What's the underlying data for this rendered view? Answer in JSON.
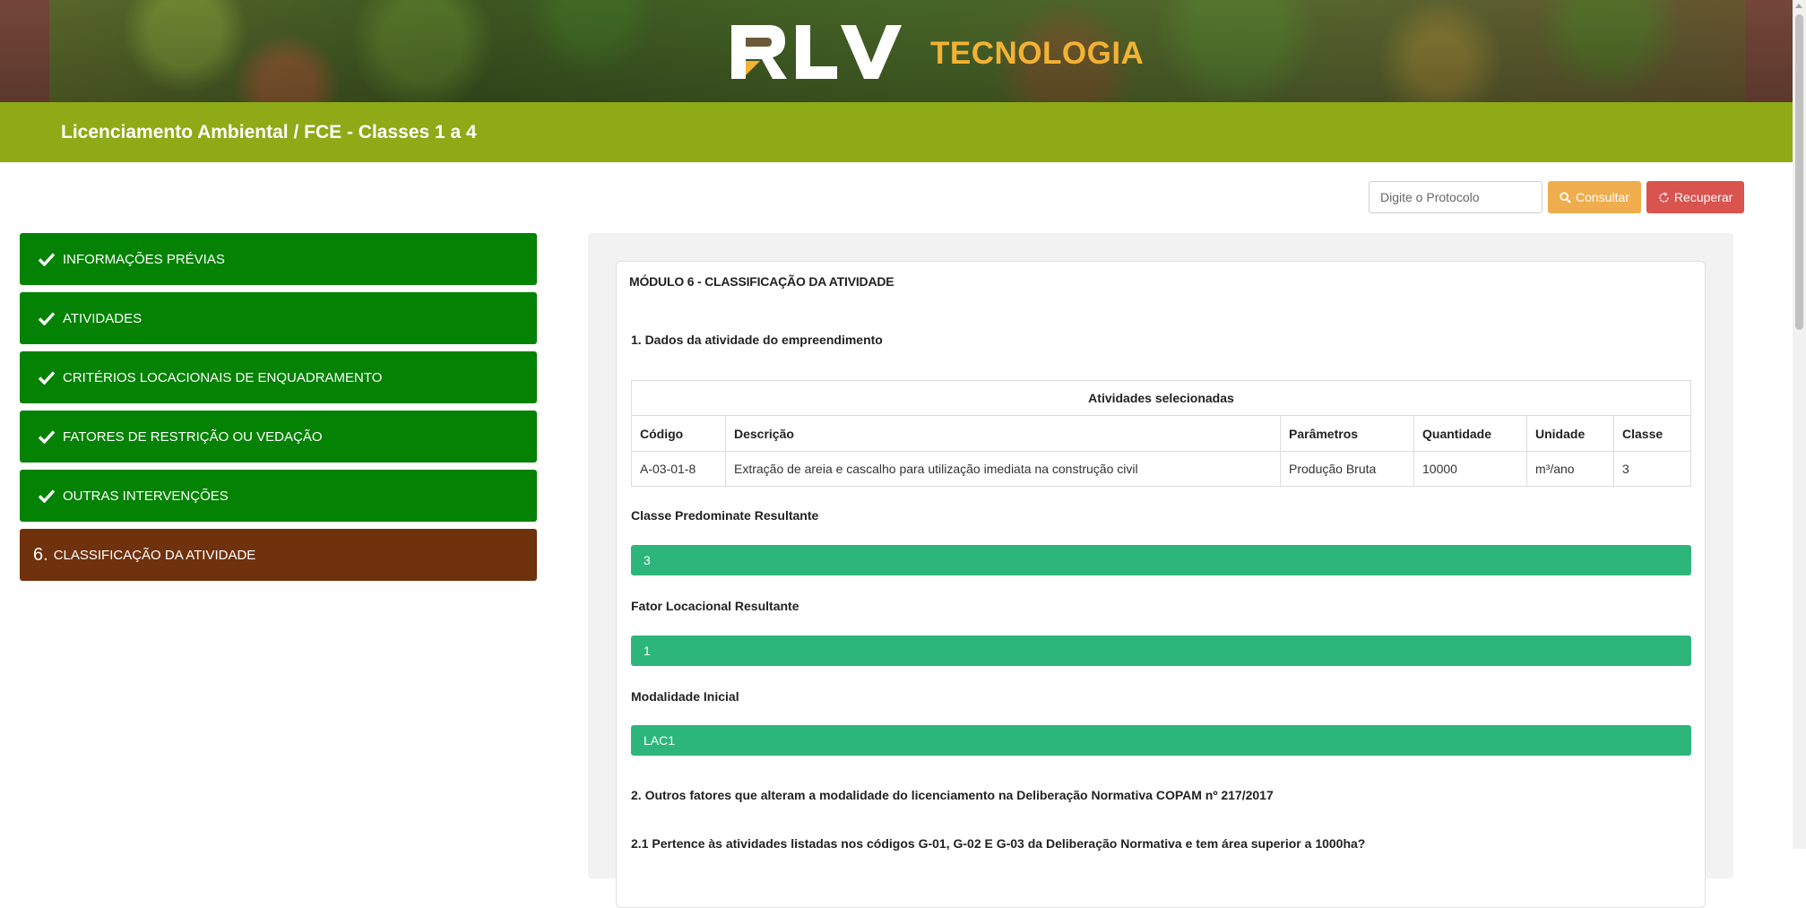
{
  "brand": {
    "logo_text": "RLV",
    "tagline": "TECNOLOGIA"
  },
  "page_title": "Licenciamento Ambiental / FCE - Classes 1 a 4",
  "search": {
    "placeholder": "Digite o Protocolo",
    "consult_label": "Consultar",
    "recover_label": "Recuperar"
  },
  "steps": [
    {
      "label": "INFORMAÇÕES PRÉVIAS",
      "status": "done"
    },
    {
      "label": "ATIVIDADES",
      "status": "done"
    },
    {
      "label": "CRITÉRIOS LOCACIONAIS DE ENQUADRAMENTO",
      "status": "done"
    },
    {
      "label": "FATORES DE RESTRIÇÃO OU VEDAÇÃO",
      "status": "done"
    },
    {
      "label": "OUTRAS INTERVENÇÕES",
      "status": "done"
    },
    {
      "number": "6.",
      "label": "CLASSIFICAÇÃO DA ATIVIDADE",
      "status": "current"
    }
  ],
  "module": {
    "title": "MÓDULO 6 - CLASSIFICAÇÃO DA ATIVIDADE",
    "section1_title": "1. Dados da atividade do empreendimento",
    "table": {
      "caption": "Atividades selecionadas",
      "headers": [
        "Código",
        "Descrição",
        "Parâmetros",
        "Quantidade",
        "Unidade",
        "Classe"
      ],
      "rows": [
        [
          "A-03-01-8",
          "Extração de areia e cascalho para utilização imediata na construção civil",
          "Produção Bruta",
          "10000",
          "m³/ano",
          "3"
        ]
      ]
    },
    "classe_label": "Classe Predominate Resultante",
    "classe_value": "3",
    "fator_label": "Fator Locacional Resultante",
    "fator_value": "1",
    "modalidade_label": "Modalidade Inicial",
    "modalidade_value": "LAC1",
    "section2_title": "2. Outros fatores que alteram a modalidade do licenciamento na Deliberação Normativa COPAM nº 217/2017",
    "section21_title": "2.1 Pertence às atividades listadas nos códigos G-01, G-02 E G-03 da Deliberação Normativa e tem área superior a 1000ha?"
  },
  "colors": {
    "title_bar": "#8eaa16",
    "step_done": "#048204",
    "step_current": "#70310d",
    "result_bar": "#2db67c",
    "consult_button": "#f0ad4e",
    "recover_button": "#d9534f",
    "tagline": "#f3b233"
  },
  "icons": {
    "step_done": "check-icon",
    "consult": "search-icon",
    "recover": "refresh-icon"
  }
}
